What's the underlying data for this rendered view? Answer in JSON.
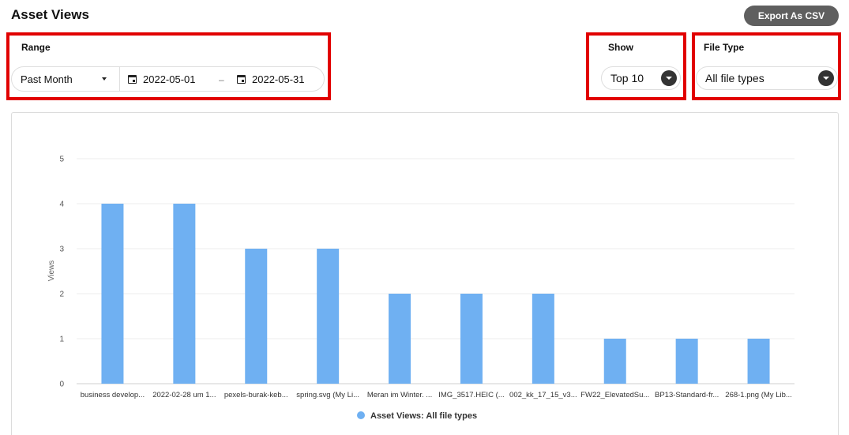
{
  "page": {
    "title": "Asset Views",
    "export_label": "Export As CSV"
  },
  "range": {
    "label": "Range",
    "preset": "Past Month",
    "start_date": "2022-05-01",
    "separator": "–",
    "end_date": "2022-05-31"
  },
  "show": {
    "label": "Show",
    "value": "Top 10"
  },
  "file_type": {
    "label": "File Type",
    "value": "All file types"
  },
  "colors": {
    "bar": "#6fb0f2",
    "highlight": "#e10000",
    "button": "#5f5f5f"
  },
  "chart_data": {
    "type": "bar",
    "categories": [
      "business develop...",
      "2022-02-28 um 1...",
      "pexels-burak-keb...",
      "spring.svg (My Li...",
      "Meran im Winter. ...",
      "IMG_3517.HEIC (...",
      "002_kk_17_15_v3...",
      "FW22_ElevatedSu...",
      "BP13-Standard-fr...",
      "268-1.png (My Lib..."
    ],
    "series": [
      {
        "name": "Asset Views: All file types",
        "values": [
          4,
          4,
          3,
          3,
          2,
          2,
          2,
          1,
          1,
          1
        ]
      }
    ],
    "ylabel": "Views",
    "ylim": [
      0,
      5
    ],
    "yticks": [
      "0",
      "1",
      "2",
      "3",
      "4",
      "5"
    ],
    "grid": true,
    "legend": "bottom"
  }
}
